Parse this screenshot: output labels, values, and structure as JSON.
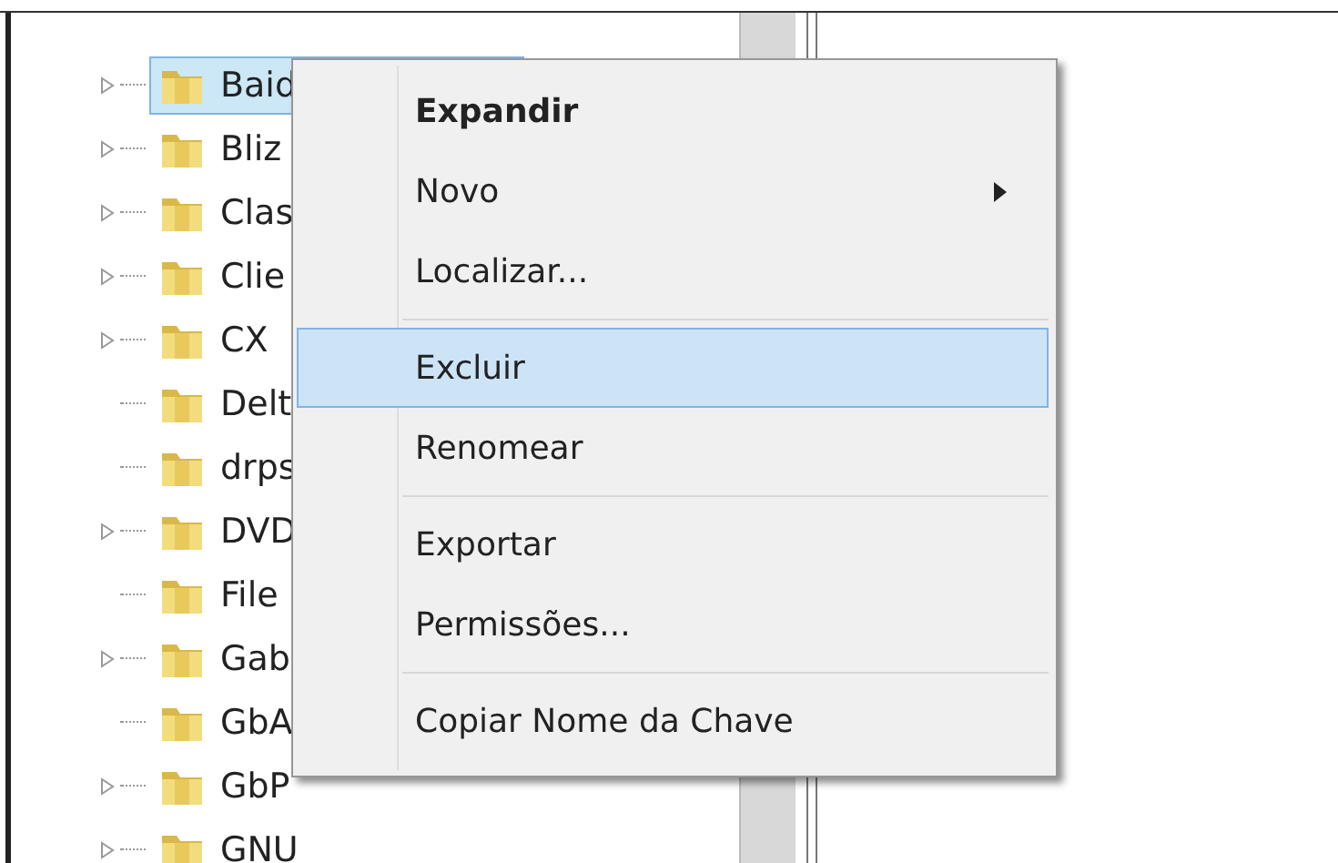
{
  "tree": {
    "items": [
      {
        "label": "Baid",
        "expandable": true,
        "selected": true
      },
      {
        "label": "Bliz",
        "expandable": true,
        "selected": false
      },
      {
        "label": "Clas",
        "expandable": true,
        "selected": false
      },
      {
        "label": "Clie",
        "expandable": true,
        "selected": false
      },
      {
        "label": "CX",
        "expandable": true,
        "selected": false
      },
      {
        "label": "Delt",
        "expandable": false,
        "selected": false
      },
      {
        "label": "drps",
        "expandable": false,
        "selected": false
      },
      {
        "label": "DVD",
        "expandable": true,
        "selected": false
      },
      {
        "label": "File",
        "expandable": false,
        "selected": false
      },
      {
        "label": "Gab",
        "expandable": true,
        "selected": false
      },
      {
        "label": "GbA",
        "expandable": false,
        "selected": false
      },
      {
        "label": "GbP",
        "expandable": true,
        "selected": false
      },
      {
        "label": "GNU",
        "expandable": true,
        "selected": false
      }
    ]
  },
  "context_menu": {
    "items": [
      {
        "kind": "item",
        "label": "Expandir",
        "default": true,
        "submenu": false,
        "selected": false
      },
      {
        "kind": "item",
        "label": "Novo",
        "default": false,
        "submenu": true,
        "selected": false
      },
      {
        "kind": "item",
        "label": "Localizar...",
        "default": false,
        "submenu": false,
        "selected": false
      },
      {
        "kind": "separator"
      },
      {
        "kind": "item",
        "label": "Excluir",
        "default": false,
        "submenu": false,
        "selected": true
      },
      {
        "kind": "item",
        "label": "Renomear",
        "default": false,
        "submenu": false,
        "selected": false
      },
      {
        "kind": "separator"
      },
      {
        "kind": "item",
        "label": "Exportar",
        "default": false,
        "submenu": false,
        "selected": false
      },
      {
        "kind": "item",
        "label": "Permissões...",
        "default": false,
        "submenu": false,
        "selected": false
      },
      {
        "kind": "separator"
      },
      {
        "kind": "item",
        "label": "Copiar Nome da Chave",
        "default": false,
        "submenu": false,
        "selected": false
      }
    ]
  }
}
